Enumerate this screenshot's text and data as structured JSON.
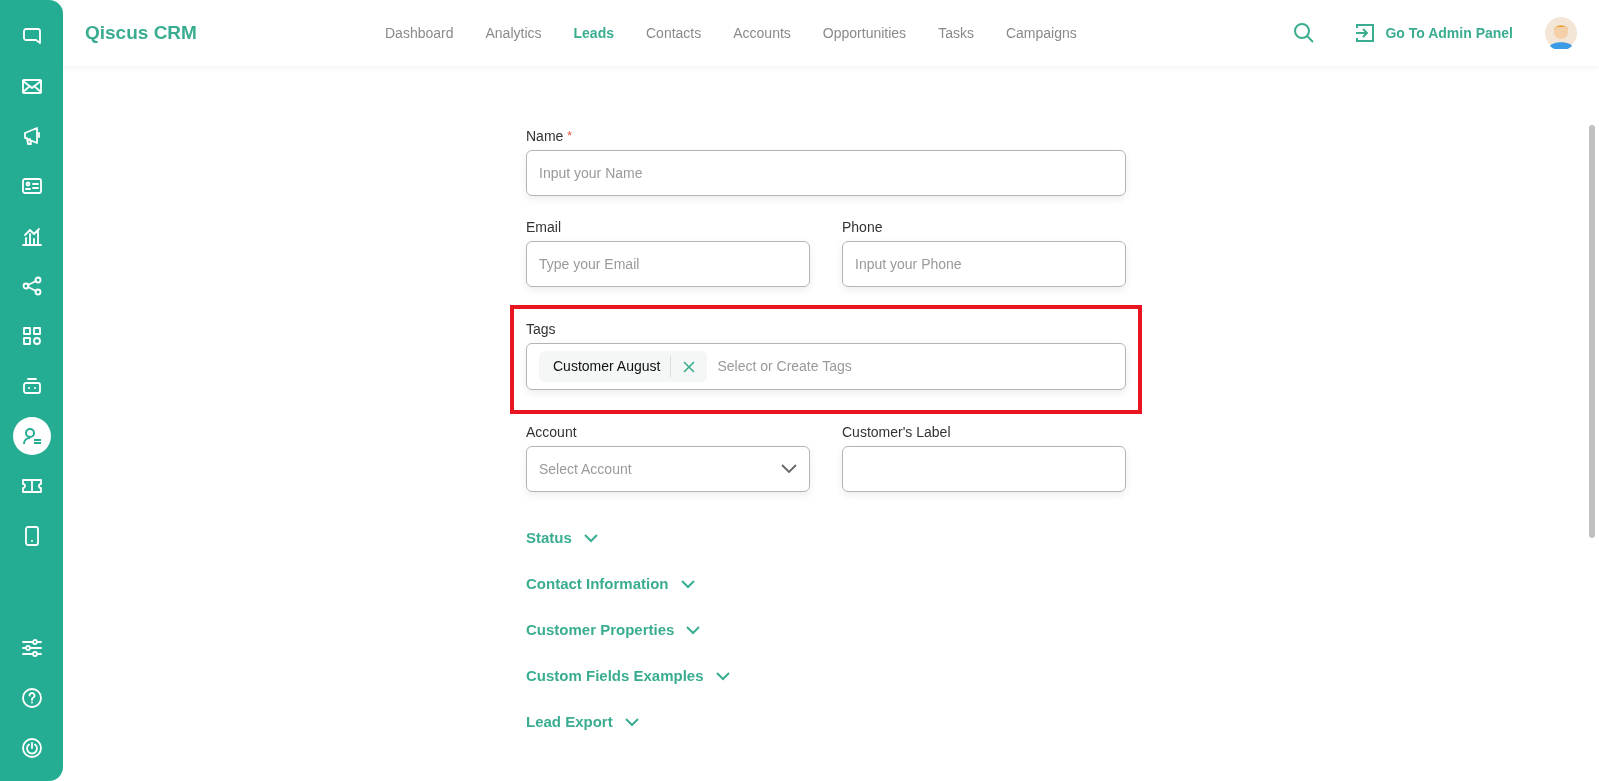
{
  "sidebar": {
    "items": [
      {
        "selected": false
      },
      {
        "selected": false
      },
      {
        "selected": false
      },
      {
        "selected": false
      },
      {
        "selected": false
      },
      {
        "selected": false
      },
      {
        "selected": false
      },
      {
        "selected": false
      },
      {
        "selected": true
      },
      {
        "selected": false
      },
      {
        "selected": false
      }
    ]
  },
  "header": {
    "logo": "Qiscus CRM",
    "nav": [
      {
        "label": "Dashboard",
        "selected": false
      },
      {
        "label": "Analytics",
        "selected": false
      },
      {
        "label": "Leads",
        "selected": true
      },
      {
        "label": "Contacts",
        "selected": false
      },
      {
        "label": "Accounts",
        "selected": false
      },
      {
        "label": "Opportunities",
        "selected": false
      },
      {
        "label": "Tasks",
        "selected": false
      },
      {
        "label": "Campaigns",
        "selected": false
      }
    ],
    "admin_link": "Go To Admin Panel"
  },
  "form": {
    "name": {
      "label": "Name",
      "required_mark": "*",
      "placeholder": "Input your Name"
    },
    "email": {
      "label": "Email",
      "placeholder": "Type your Email"
    },
    "phone": {
      "label": "Phone",
      "placeholder": "Input your Phone"
    },
    "tags": {
      "label": "Tags",
      "highlighted": true,
      "chips": [
        "Customer August"
      ],
      "placeholder": "Select or Create Tags"
    },
    "account": {
      "label": "Account",
      "placeholder": "Select Account"
    },
    "customers_label": {
      "label": "Customer's Label"
    },
    "sections": [
      {
        "title": "Status",
        "expanded": false
      },
      {
        "title": "Contact Information",
        "expanded": false
      },
      {
        "title": "Customer Properties",
        "expanded": false
      },
      {
        "title": "Custom Fields Examples",
        "expanded": false
      },
      {
        "title": "Lead Export",
        "expanded": false
      }
    ]
  }
}
